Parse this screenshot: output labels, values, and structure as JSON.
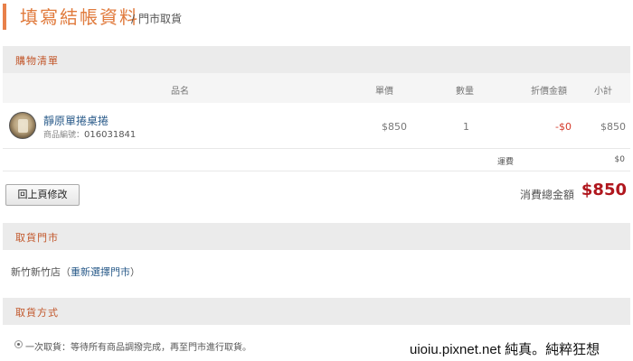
{
  "header": {
    "title": "填寫結帳資料",
    "breadcrumb_sep": "/",
    "breadcrumb_current": "門市取貨"
  },
  "cart": {
    "section_title": "購物清單",
    "columns": {
      "name": "品名",
      "price": "單價",
      "qty": "數量",
      "discount": "折價金額",
      "subtotal": "小計"
    },
    "items": [
      {
        "name": "靜原單捲桌捲",
        "code_label": "商品編號：",
        "code": "016031841",
        "price": "$850",
        "qty": "1",
        "discount": "-$0",
        "subtotal": "$850"
      }
    ],
    "shipping_label": "運費",
    "shipping_value": "$0",
    "back_button": "回上頁修改",
    "total_label": "消費總金額",
    "total_value": "$850"
  },
  "store": {
    "section_title": "取貨門市",
    "store_name": "新竹新竹店",
    "paren_open": "（",
    "reselect_link": "重新選擇門市",
    "paren_close": "）"
  },
  "pickup": {
    "section_title": "取貨方式",
    "option_label": "一次取貨：等待所有商品調撥完成，再至門市進行取貨。"
  },
  "watermark": "uioiu.pixnet.net 純真。純粹狂想",
  "colors": {
    "accent": "#e07a3c",
    "section_title": "#c2572b",
    "link": "#2a5b8a",
    "total": "#b0171e",
    "discount": "#d43a2a"
  }
}
